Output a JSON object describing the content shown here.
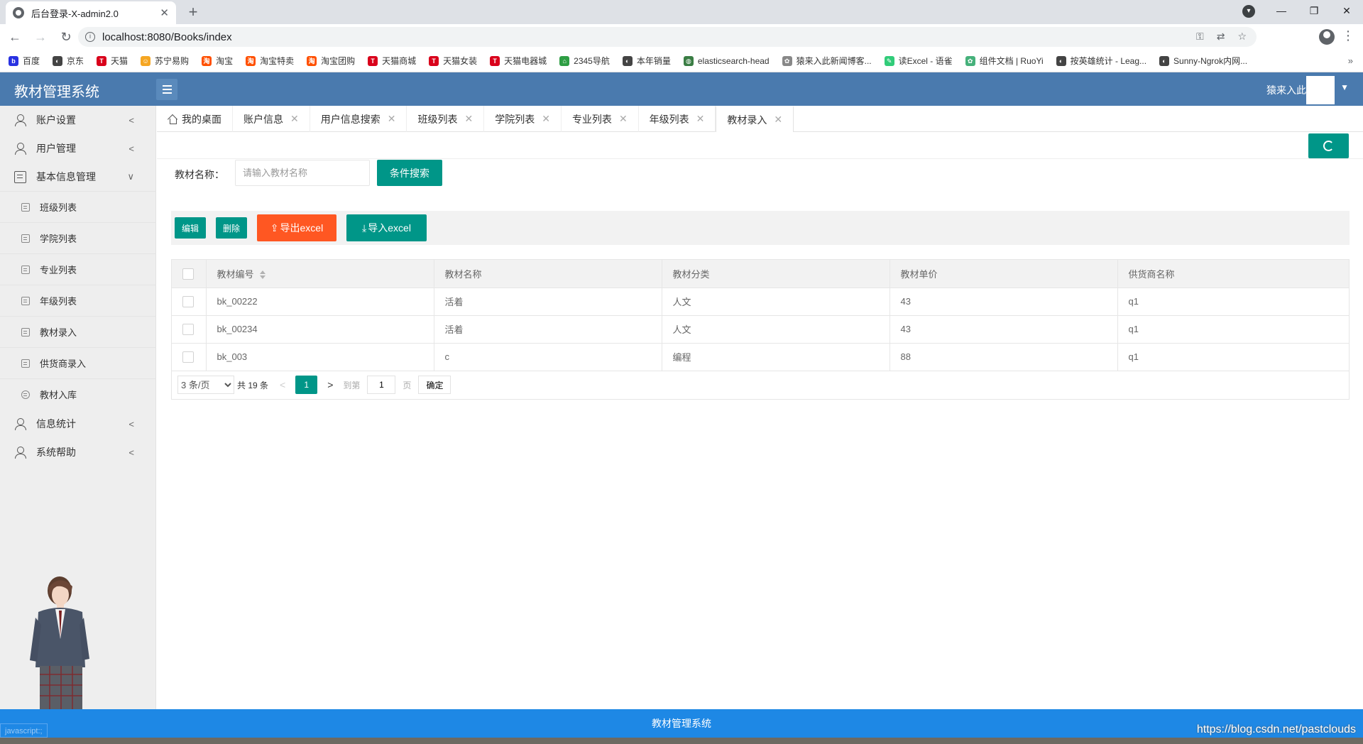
{
  "browser": {
    "tab_title": "后台登录-X-admin2.0",
    "url": "localhost:8080/Books/index",
    "bookmarks": [
      {
        "label": "百度",
        "color": "#2932e1",
        "glyph": "b"
      },
      {
        "label": "京东",
        "color": "#444444",
        "glyph": "◐"
      },
      {
        "label": "天猫",
        "color": "#d9001b",
        "glyph": "T"
      },
      {
        "label": "苏宁易购",
        "color": "#f5a623",
        "glyph": "☺"
      },
      {
        "label": "淘宝",
        "color": "#ff5000",
        "glyph": "淘"
      },
      {
        "label": "淘宝特卖",
        "color": "#ff5000",
        "glyph": "淘"
      },
      {
        "label": "淘宝团购",
        "color": "#ff5000",
        "glyph": "淘"
      },
      {
        "label": "天猫商城",
        "color": "#d9001b",
        "glyph": "T"
      },
      {
        "label": "天猫女装",
        "color": "#d9001b",
        "glyph": "T"
      },
      {
        "label": "天猫电器城",
        "color": "#d9001b",
        "glyph": "T"
      },
      {
        "label": "2345导航",
        "color": "#2e9e44",
        "glyph": "⌂"
      },
      {
        "label": "本年销量",
        "color": "#444444",
        "glyph": "◐"
      },
      {
        "label": "elasticsearch-head",
        "color": "#3a7d44",
        "glyph": "◍"
      },
      {
        "label": "猿来入此新闻博客...",
        "color": "#888888",
        "glyph": "✿"
      },
      {
        "label": "读Excel - 语雀",
        "color": "#31cc79",
        "glyph": "✎"
      },
      {
        "label": "组件文档 | RuoYi",
        "color": "#46b17b",
        "glyph": "✿"
      },
      {
        "label": "按英雄统计 - Leag...",
        "color": "#444444",
        "glyph": "◐"
      },
      {
        "label": "Sunny-Ngrok内网...",
        "color": "#444444",
        "glyph": "◐"
      }
    ],
    "more": "»"
  },
  "header": {
    "logo": "教材管理系统",
    "username": "猿来入此"
  },
  "sidebar": {
    "items": [
      {
        "label": "账户设置",
        "arrow": "<"
      },
      {
        "label": "用户管理",
        "arrow": "<"
      },
      {
        "label": "基本信息管理",
        "arrow": "∨"
      }
    ],
    "subitems": [
      {
        "label": "班级列表"
      },
      {
        "label": "学院列表"
      },
      {
        "label": "专业列表"
      },
      {
        "label": "年级列表"
      },
      {
        "label": "教材录入"
      },
      {
        "label": "供货商录入"
      },
      {
        "label": "教材入库"
      }
    ],
    "items_after": [
      {
        "label": "信息统计",
        "arrow": "<"
      },
      {
        "label": "系统帮助",
        "arrow": "<"
      }
    ]
  },
  "tabs": [
    {
      "label": "我的桌面",
      "closable": false
    },
    {
      "label": "账户信息",
      "closable": true
    },
    {
      "label": "用户信息搜索",
      "closable": true
    },
    {
      "label": "班级列表",
      "closable": true
    },
    {
      "label": "学院列表",
      "closable": true
    },
    {
      "label": "专业列表",
      "closable": true
    },
    {
      "label": "年级列表",
      "closable": true
    },
    {
      "label": "教材录入",
      "closable": true,
      "active": true
    }
  ],
  "search": {
    "label": "教材名称：",
    "placeholder": "请输入教材名称",
    "button": "条件搜索"
  },
  "toolbar": {
    "edit": "编辑",
    "delete": "删除",
    "export": "导出excel",
    "import": "导入excel"
  },
  "table": {
    "headers": [
      "教材编号",
      "教材名称",
      "教材分类",
      "教材单价",
      "供货商名称"
    ],
    "rows": [
      [
        "bk_00222",
        "活着",
        "人文",
        "43",
        "q1"
      ],
      [
        "bk_00234",
        "活着",
        "人文",
        "43",
        "q1"
      ],
      [
        "bk_003",
        "c",
        "编程",
        "88",
        "q1"
      ]
    ]
  },
  "pager": {
    "per_page": "3 条/页",
    "total": "共 19 条",
    "current": "1",
    "goto": "到第",
    "page_input": "1",
    "page_unit": "页",
    "confirm": "确定"
  },
  "footer": {
    "text": "教材管理系统",
    "watermark": "https://blog.csdn.net/pastclouds",
    "status": "javascript:;"
  }
}
